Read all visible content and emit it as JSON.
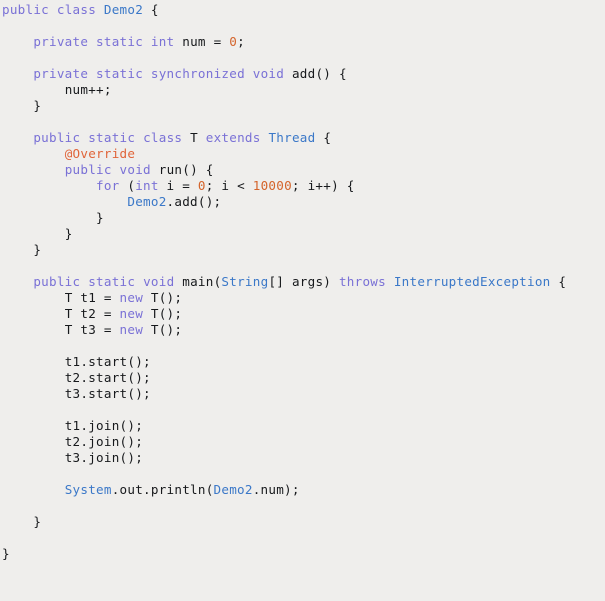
{
  "editor": {
    "language": "java",
    "background_color": "#efeeec",
    "default_text_color": "#17191c",
    "colors": {
      "keyword": "#7a71d6",
      "type": "#3b78c8",
      "number": "#d4642b",
      "annotation": "#e0653a",
      "plain": "#17191c"
    }
  },
  "code": {
    "lines": [
      {
        "n": 1,
        "indent": 0,
        "tokens": [
          {
            "t": "public",
            "c": "kw"
          },
          {
            "t": " ",
            "c": "plain"
          },
          {
            "t": "class",
            "c": "kw"
          },
          {
            "t": " ",
            "c": "plain"
          },
          {
            "t": "Demo2",
            "c": "type"
          },
          {
            "t": " ",
            "c": "plain"
          },
          {
            "t": "{",
            "c": "brace"
          }
        ]
      },
      {
        "n": 2,
        "indent": 0,
        "tokens": []
      },
      {
        "n": 3,
        "indent": 1,
        "tokens": [
          {
            "t": "private",
            "c": "kw"
          },
          {
            "t": " ",
            "c": "plain"
          },
          {
            "t": "static",
            "c": "kw"
          },
          {
            "t": " ",
            "c": "plain"
          },
          {
            "t": "int",
            "c": "kw"
          },
          {
            "t": " ",
            "c": "plain"
          },
          {
            "t": "num",
            "c": "plain"
          },
          {
            "t": " = ",
            "c": "plain"
          },
          {
            "t": "0",
            "c": "num"
          },
          {
            "t": ";",
            "c": "plain"
          }
        ]
      },
      {
        "n": 4,
        "indent": 0,
        "tokens": []
      },
      {
        "n": 5,
        "indent": 1,
        "tokens": [
          {
            "t": "private",
            "c": "kw"
          },
          {
            "t": " ",
            "c": "plain"
          },
          {
            "t": "static",
            "c": "kw"
          },
          {
            "t": " ",
            "c": "plain"
          },
          {
            "t": "synchronized",
            "c": "kw"
          },
          {
            "t": " ",
            "c": "plain"
          },
          {
            "t": "void",
            "c": "kw"
          },
          {
            "t": " ",
            "c": "plain"
          },
          {
            "t": "add() ",
            "c": "plain"
          },
          {
            "t": "{",
            "c": "brace"
          }
        ]
      },
      {
        "n": 6,
        "indent": 2,
        "tokens": [
          {
            "t": "num++;",
            "c": "plain"
          }
        ]
      },
      {
        "n": 7,
        "indent": 1,
        "tokens": [
          {
            "t": "}",
            "c": "brace"
          }
        ]
      },
      {
        "n": 8,
        "indent": 0,
        "tokens": []
      },
      {
        "n": 9,
        "indent": 1,
        "tokens": [
          {
            "t": "public",
            "c": "kw"
          },
          {
            "t": " ",
            "c": "plain"
          },
          {
            "t": "static",
            "c": "kw"
          },
          {
            "t": " ",
            "c": "plain"
          },
          {
            "t": "class",
            "c": "kw"
          },
          {
            "t": " ",
            "c": "plain"
          },
          {
            "t": "T",
            "c": "plain"
          },
          {
            "t": " ",
            "c": "plain"
          },
          {
            "t": "extends",
            "c": "kw"
          },
          {
            "t": " ",
            "c": "plain"
          },
          {
            "t": "Thread",
            "c": "type"
          },
          {
            "t": " ",
            "c": "plain"
          },
          {
            "t": "{",
            "c": "brace"
          }
        ]
      },
      {
        "n": 10,
        "indent": 2,
        "tokens": [
          {
            "t": "@Override",
            "c": "anno"
          }
        ]
      },
      {
        "n": 11,
        "indent": 2,
        "tokens": [
          {
            "t": "public",
            "c": "kw"
          },
          {
            "t": " ",
            "c": "plain"
          },
          {
            "t": "void",
            "c": "kw"
          },
          {
            "t": " ",
            "c": "plain"
          },
          {
            "t": "run() ",
            "c": "plain"
          },
          {
            "t": "{",
            "c": "brace"
          }
        ]
      },
      {
        "n": 12,
        "indent": 3,
        "tokens": [
          {
            "t": "for",
            "c": "kw"
          },
          {
            "t": " (",
            "c": "plain"
          },
          {
            "t": "int",
            "c": "kw"
          },
          {
            "t": " i = ",
            "c": "plain"
          },
          {
            "t": "0",
            "c": "num"
          },
          {
            "t": "; i < ",
            "c": "plain"
          },
          {
            "t": "10000",
            "c": "num"
          },
          {
            "t": "; i++) ",
            "c": "plain"
          },
          {
            "t": "{",
            "c": "brace"
          }
        ]
      },
      {
        "n": 13,
        "indent": 4,
        "tokens": [
          {
            "t": "Demo2",
            "c": "type"
          },
          {
            "t": ".add();",
            "c": "plain"
          }
        ]
      },
      {
        "n": 14,
        "indent": 3,
        "tokens": [
          {
            "t": "}",
            "c": "brace"
          }
        ]
      },
      {
        "n": 15,
        "indent": 2,
        "tokens": [
          {
            "t": "}",
            "c": "brace"
          }
        ]
      },
      {
        "n": 16,
        "indent": 1,
        "tokens": [
          {
            "t": "}",
            "c": "brace"
          }
        ]
      },
      {
        "n": 17,
        "indent": 0,
        "tokens": []
      },
      {
        "n": 18,
        "indent": 1,
        "tokens": [
          {
            "t": "public",
            "c": "kw"
          },
          {
            "t": " ",
            "c": "plain"
          },
          {
            "t": "static",
            "c": "kw"
          },
          {
            "t": " ",
            "c": "plain"
          },
          {
            "t": "void",
            "c": "kw"
          },
          {
            "t": " ",
            "c": "plain"
          },
          {
            "t": "main(",
            "c": "plain"
          },
          {
            "t": "String",
            "c": "type"
          },
          {
            "t": "[] args) ",
            "c": "plain"
          },
          {
            "t": "throws",
            "c": "kw"
          },
          {
            "t": " ",
            "c": "plain"
          },
          {
            "t": "InterruptedException",
            "c": "type"
          },
          {
            "t": " ",
            "c": "plain"
          },
          {
            "t": "{",
            "c": "brace"
          }
        ]
      },
      {
        "n": 19,
        "indent": 2,
        "tokens": [
          {
            "t": "T t1 = ",
            "c": "plain"
          },
          {
            "t": "new",
            "c": "kw"
          },
          {
            "t": " T();",
            "c": "plain"
          }
        ]
      },
      {
        "n": 20,
        "indent": 2,
        "tokens": [
          {
            "t": "T t2 = ",
            "c": "plain"
          },
          {
            "t": "new",
            "c": "kw"
          },
          {
            "t": " T();",
            "c": "plain"
          }
        ]
      },
      {
        "n": 21,
        "indent": 2,
        "tokens": [
          {
            "t": "T t3 = ",
            "c": "plain"
          },
          {
            "t": "new",
            "c": "kw"
          },
          {
            "t": " T();",
            "c": "plain"
          }
        ]
      },
      {
        "n": 22,
        "indent": 0,
        "tokens": []
      },
      {
        "n": 23,
        "indent": 2,
        "tokens": [
          {
            "t": "t1.start();",
            "c": "plain"
          }
        ]
      },
      {
        "n": 24,
        "indent": 2,
        "tokens": [
          {
            "t": "t2.start();",
            "c": "plain"
          }
        ]
      },
      {
        "n": 25,
        "indent": 2,
        "tokens": [
          {
            "t": "t3.start();",
            "c": "plain"
          }
        ]
      },
      {
        "n": 26,
        "indent": 0,
        "tokens": []
      },
      {
        "n": 27,
        "indent": 2,
        "tokens": [
          {
            "t": "t1.join();",
            "c": "plain"
          }
        ]
      },
      {
        "n": 28,
        "indent": 2,
        "tokens": [
          {
            "t": "t2.join();",
            "c": "plain"
          }
        ]
      },
      {
        "n": 29,
        "indent": 2,
        "tokens": [
          {
            "t": "t3.join();",
            "c": "plain"
          }
        ]
      },
      {
        "n": 30,
        "indent": 0,
        "tokens": []
      },
      {
        "n": 31,
        "indent": 2,
        "tokens": [
          {
            "t": "System",
            "c": "type"
          },
          {
            "t": ".out.println(",
            "c": "plain"
          },
          {
            "t": "Demo2",
            "c": "type"
          },
          {
            "t": ".num);",
            "c": "plain"
          }
        ]
      },
      {
        "n": 32,
        "indent": 0,
        "tokens": []
      },
      {
        "n": 33,
        "indent": 1,
        "tokens": [
          {
            "t": "}",
            "c": "brace"
          }
        ]
      },
      {
        "n": 34,
        "indent": 0,
        "tokens": []
      },
      {
        "n": 35,
        "indent": 0,
        "tokens": [
          {
            "t": "}",
            "c": "brace"
          }
        ]
      }
    ]
  }
}
